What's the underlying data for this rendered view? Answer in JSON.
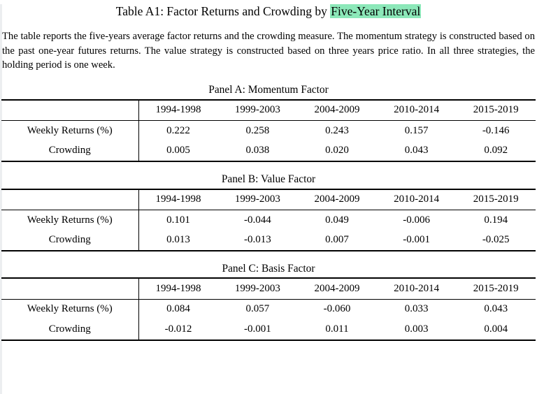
{
  "document": {
    "title_prefix": "Table A1: Factor Returns and Crowding by ",
    "title_highlight": "Five-Year Interval",
    "highlight_color": "#8ce8b9",
    "note": "The table reports the five-years average factor returns and the crowding measure. The momentum strategy is constructed based on the past one-year futures returns. The value strategy is constructed based on three years price ratio. In all three strategies, the holding period is one week."
  },
  "chart_data": {
    "type": "table",
    "title": "Table A1: Factor Returns and Crowding by Five-Year Interval",
    "categories": [
      "1994-1998",
      "1999-2003",
      "2004-2009",
      "2010-2014",
      "2015-2019"
    ],
    "panels": [
      {
        "title": "Panel A: Momentum Factor",
        "corner_label": "",
        "rows": [
          {
            "label": "Weekly Returns (%)",
            "values": [
              "0.222",
              "0.258",
              "0.243",
              "0.157",
              "-0.146"
            ]
          },
          {
            "label": "Crowding",
            "values": [
              "0.005",
              "0.038",
              "0.020",
              "0.043",
              "0.092"
            ]
          }
        ]
      },
      {
        "title": "Panel B: Value Factor",
        "corner_label": "",
        "rows": [
          {
            "label": "Weekly Returns (%)",
            "values": [
              "0.101",
              "-0.044",
              "0.049",
              "-0.006",
              "0.194"
            ]
          },
          {
            "label": "Crowding",
            "values": [
              "0.013",
              "-0.013",
              "0.007",
              "-0.001",
              "-0.025"
            ]
          }
        ]
      },
      {
        "title": "Panel C: Basis Factor",
        "corner_label": "",
        "rows": [
          {
            "label": "Weekly Returns (%)",
            "values": [
              "0.084",
              "0.057",
              "-0.060",
              "0.033",
              "0.043"
            ]
          },
          {
            "label": "Crowding",
            "values": [
              "-0.012",
              "-0.001",
              "0.011",
              "0.003",
              "0.004"
            ]
          }
        ]
      }
    ]
  }
}
